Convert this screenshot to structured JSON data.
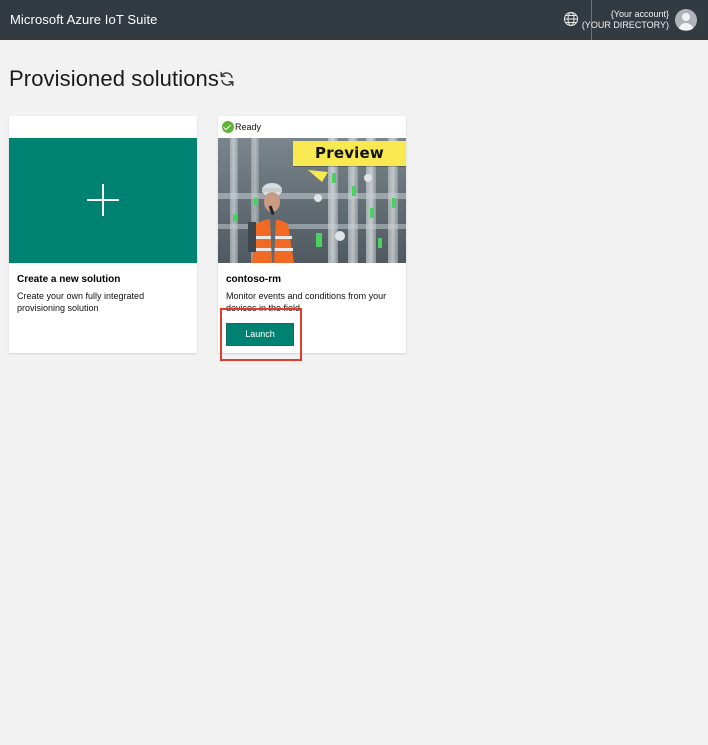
{
  "header": {
    "title": "Microsoft Azure IoT Suite",
    "account_name": "{Your account}",
    "directory": "(YOUR DIRECTORY)",
    "globe_icon": "globe-icon",
    "avatar_icon": "avatar-icon"
  },
  "main": {
    "page_title": "Provisioned solutions",
    "refresh_icon": "refresh-icon"
  },
  "cards": {
    "new": {
      "title": "Create a new solution",
      "description": "Create your own fully integrated provisioning solution",
      "icon": "plus-icon",
      "accent": "#008272"
    },
    "existing": {
      "status": "Ready",
      "status_color": "#5fb33a",
      "preview_label": "Preview",
      "title": "contoso-rm",
      "description": "Monitor events and conditions from your devices in the field",
      "launch_label": "Launch",
      "button_color": "#008272"
    }
  },
  "annotation": {
    "highlight_color": "#e03b2b"
  }
}
